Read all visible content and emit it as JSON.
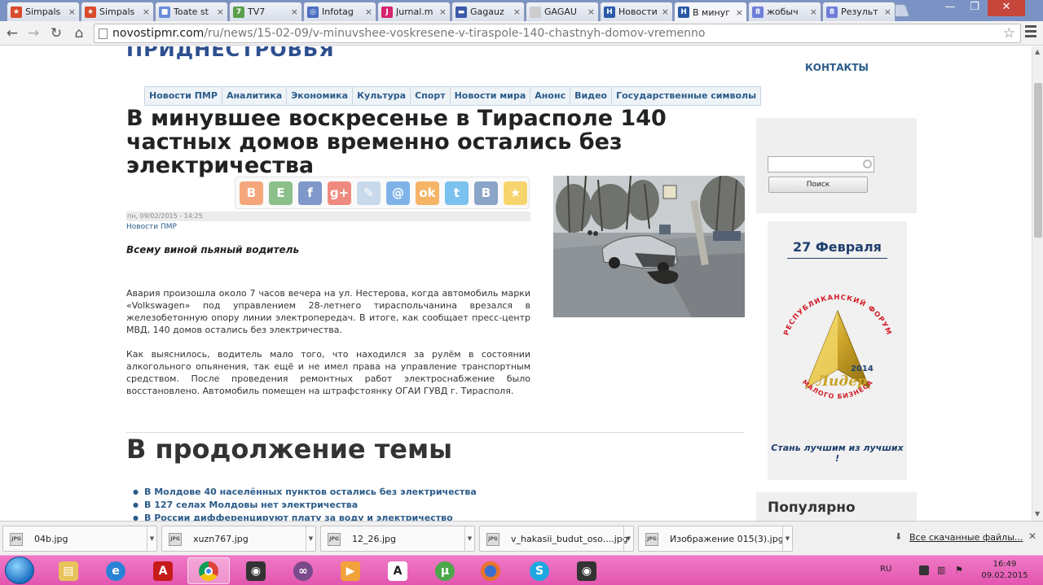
{
  "browser": {
    "tabs": [
      {
        "title": "Simpals",
        "color": "#d94b2b",
        "glyph": "★"
      },
      {
        "title": "Simpals",
        "color": "#d94b2b",
        "glyph": "★"
      },
      {
        "title": "Toate st",
        "color": "#6a8ed8",
        "glyph": "■"
      },
      {
        "title": "TV7",
        "color": "#5aa04a",
        "glyph": "7"
      },
      {
        "title": "Infotag",
        "color": "#4a6ec2",
        "glyph": "◎"
      },
      {
        "title": "Jurnal.m",
        "color": "#d6246e",
        "glyph": "J"
      },
      {
        "title": "Gagauz",
        "color": "#3b59a8",
        "glyph": "▬"
      },
      {
        "title": "GAGAU",
        "color": "#cccccc",
        "glyph": ""
      },
      {
        "title": "Новости",
        "color": "#2a5aa8",
        "glyph": "Н"
      },
      {
        "title": "В минуг",
        "color": "#2a5aa8",
        "glyph": "Н",
        "active": true
      },
      {
        "title": "жобыч",
        "color": "#6f7fd8",
        "glyph": "8"
      },
      {
        "title": "Результ",
        "color": "#6f7fd8",
        "glyph": "8"
      }
    ],
    "url_host": "novostipmr.com",
    "url_path": "/ru/news/15-02-09/v-minuvshee-voskresene-v-tiraspole-140-chastnyh-domov-vremenno"
  },
  "site": {
    "logo_fragment": "ПРИДНЕСТРОВЬЯ",
    "contacts_label": "КОНТАКТЫ",
    "top_fragment": "• ... ...",
    "nav": [
      "Новости ПМР",
      "Аналитика",
      "Экономика",
      "Культура",
      "Спорт",
      "Новости мира",
      "Анонс",
      "Видео",
      "Государственные символы"
    ],
    "search_button": "Поиск",
    "popular_title": "Популярно"
  },
  "article": {
    "title": "В минувшее воскресенье в Тирасполе 140 частных домов временно остались без электричества",
    "date": "пн, 09/02/2015 - 14:25",
    "category": "Новости ПМР",
    "lead": "Всему виной пьяный водитель",
    "paragraph1": "Авария произошла около 7 часов вечера на ул. Нестерова, когда автомобиль марки «Volkswagen» под управлением 28-летнего тираспольчанина врезался в железобетонную опору линии электропередач. В итоге, как сообщает пресс-центр МВД, 140 домов остались без электричества.",
    "paragraph2": "Как выяснилось, водитель мало того, что находился за рулём в состоянии алкогольного опьянения, так ещё и не имел права на управление транспортным средством. После проведения ремонтных работ электроснабжение было восстановлено. Автомобиль помещен на штрафстоянку ОГАИ ГУВД г. Тирасполя.",
    "share_buttons": [
      {
        "name": "blogger",
        "color": "#f5a77b",
        "glyph": "B"
      },
      {
        "name": "evernote",
        "color": "#8bc08a",
        "glyph": "E"
      },
      {
        "name": "facebook",
        "color": "#7f97c9",
        "glyph": "f"
      },
      {
        "name": "google-plus",
        "color": "#ef8a7e",
        "glyph": "g+"
      },
      {
        "name": "livejournal",
        "color": "#c9d9ec",
        "glyph": "✎"
      },
      {
        "name": "mail-ru",
        "color": "#7fb3e8",
        "glyph": "@"
      },
      {
        "name": "odnoklassniki",
        "color": "#f6b467",
        "glyph": "ok"
      },
      {
        "name": "twitter",
        "color": "#7cc2ee",
        "glyph": "t"
      },
      {
        "name": "vkontakte",
        "color": "#8aa5c8",
        "glyph": "В"
      },
      {
        "name": "favorite",
        "color": "#f7d56d",
        "glyph": "★"
      }
    ]
  },
  "related": {
    "title": "В продолжение темы",
    "items": [
      "В Молдове 40 населённых пунктов остались без электричества",
      "В 127 селах Молдовы нет электричества",
      "В России дифференцируют плату за воду и электричество"
    ]
  },
  "banner": {
    "date": "27 Февраля",
    "arc_text": "РЕСПУБЛИКАНСКИЙ ФОРУМ",
    "year": "2014",
    "brand": "Лидер",
    "bottom_arc": "МАЛОГО БИЗНЕСА",
    "slogan": "Стань лучшим из лучших !"
  },
  "downloads": {
    "items": [
      "04b.jpg",
      "xuzn767.jpg",
      "12_26.jpg",
      "v_hakasii_budut_oso....jpg",
      "Изображение 015(3).jpg"
    ],
    "all_label": "Все скачанные файлы..."
  },
  "taskbar": {
    "language": "RU",
    "time": "16:49",
    "date": "09.02.2015"
  }
}
